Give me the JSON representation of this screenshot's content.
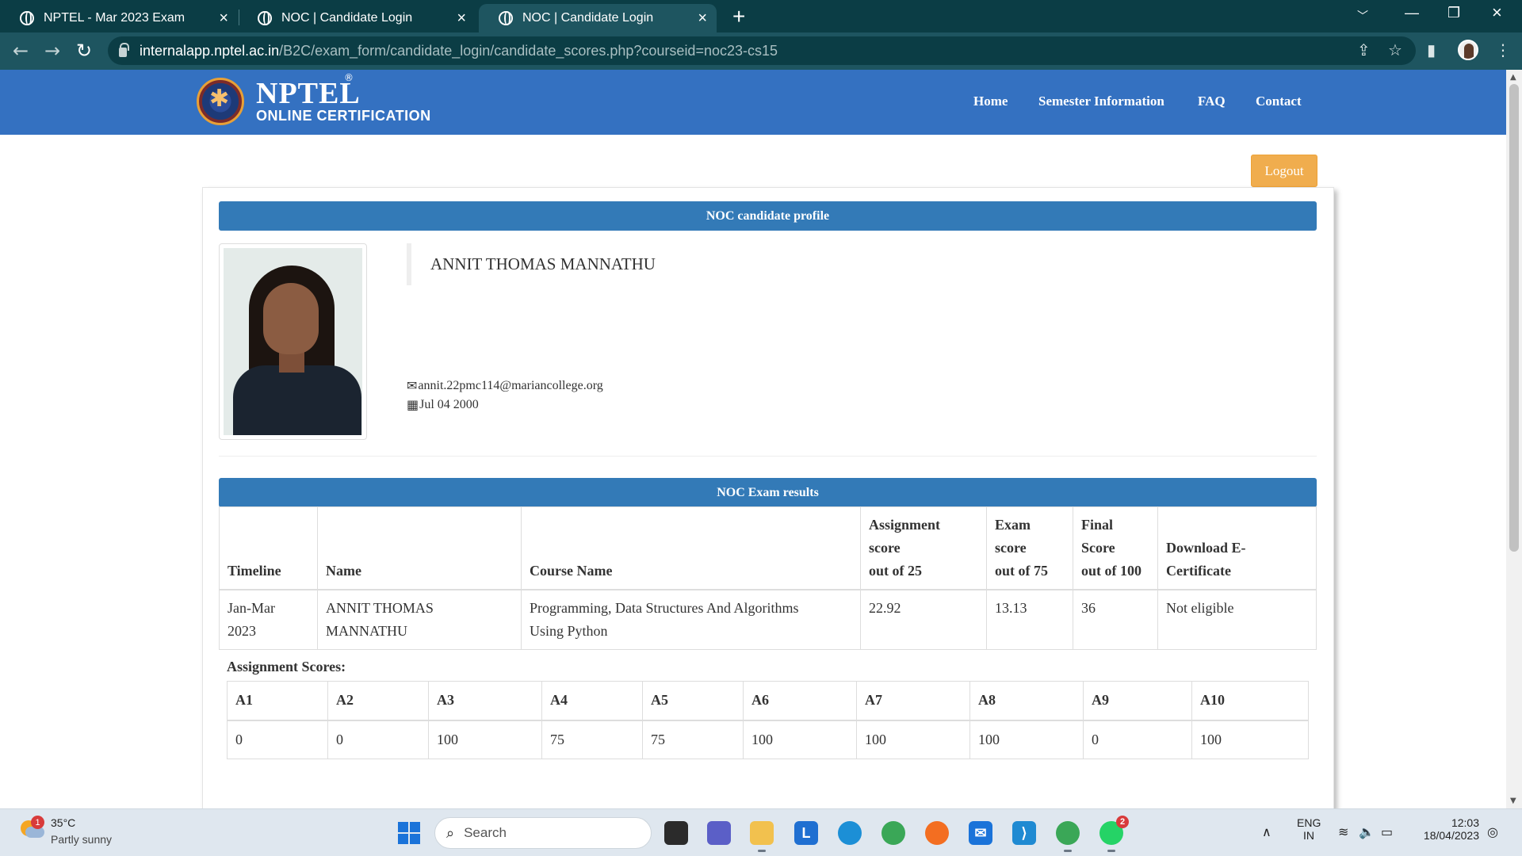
{
  "browser": {
    "tabs": [
      {
        "title": "NPTEL - Mar 2023 Exam",
        "active": false
      },
      {
        "title": "NOC | Candidate Login",
        "active": false
      },
      {
        "title": "NOC | Candidate Login",
        "active": true
      }
    ],
    "url_host": "internalapp.nptel.ac.in",
    "url_path": "/B2C/exam_form/candidate_login/candidate_scores.php?courseid=noc23-cs15"
  },
  "site": {
    "logo_title": "NPTEL",
    "logo_reg": "®",
    "logo_sub": "ONLINE CERTIFICATION",
    "nav": [
      "Home",
      "Semester Information",
      "FAQ",
      "Contact"
    ],
    "logout_label": "Logout"
  },
  "profile": {
    "section_title": "NOC candidate profile",
    "name": "ANNIT THOMAS MANNATHU",
    "email": "annit.22pmc114@mariancollege.org",
    "dob": "Jul 04 2000"
  },
  "results": {
    "section_title": "NOC Exam results",
    "headers": {
      "timeline": "Timeline",
      "name": "Name",
      "course": "Course Name",
      "assignment_l1": "Assignment",
      "assignment_l2": "score",
      "assignment_l3": "out of 25",
      "exam_l1": "Exam",
      "exam_l2": "score",
      "exam_l3": "out of 75",
      "final_l1": "Final",
      "final_l2": "Score",
      "final_l3": "out of 100",
      "download_l1": "Download E-",
      "download_l2": "Certificate"
    },
    "row": {
      "timeline_l1": "Jan-Mar",
      "timeline_l2": "2023",
      "name_l1": "ANNIT THOMAS",
      "name_l2": "MANNATHU",
      "course_l1": "Programming, Data Structures And Algorithms",
      "course_l2": "Using Python",
      "assignment_score": "22.92",
      "exam_score": "13.13",
      "final_score": "36",
      "certificate": "Not eligible"
    },
    "assignment_label": "Assignment Scores:",
    "assignments": [
      {
        "name": "A1",
        "score": "0"
      },
      {
        "name": "A2",
        "score": "0"
      },
      {
        "name": "A3",
        "score": "100"
      },
      {
        "name": "A4",
        "score": "75"
      },
      {
        "name": "A5",
        "score": "75"
      },
      {
        "name": "A6",
        "score": "100"
      },
      {
        "name": "A7",
        "score": "100"
      },
      {
        "name": "A8",
        "score": "100"
      },
      {
        "name": "A9",
        "score": "0"
      },
      {
        "name": "A10",
        "score": "100"
      }
    ]
  },
  "taskbar": {
    "weather_badge": "1",
    "temperature": "35°C",
    "weather": "Partly sunny",
    "search_placeholder": "Search",
    "lang_l1": "ENG",
    "lang_l2": "IN",
    "time": "12:03",
    "date": "18/04/2023",
    "chrome_badge": "2"
  },
  "colors": {
    "site_header": "#3471c1",
    "section_bar": "#337ab7",
    "logout": "#f0ad4e",
    "browser_frame": "#0b3d45"
  }
}
